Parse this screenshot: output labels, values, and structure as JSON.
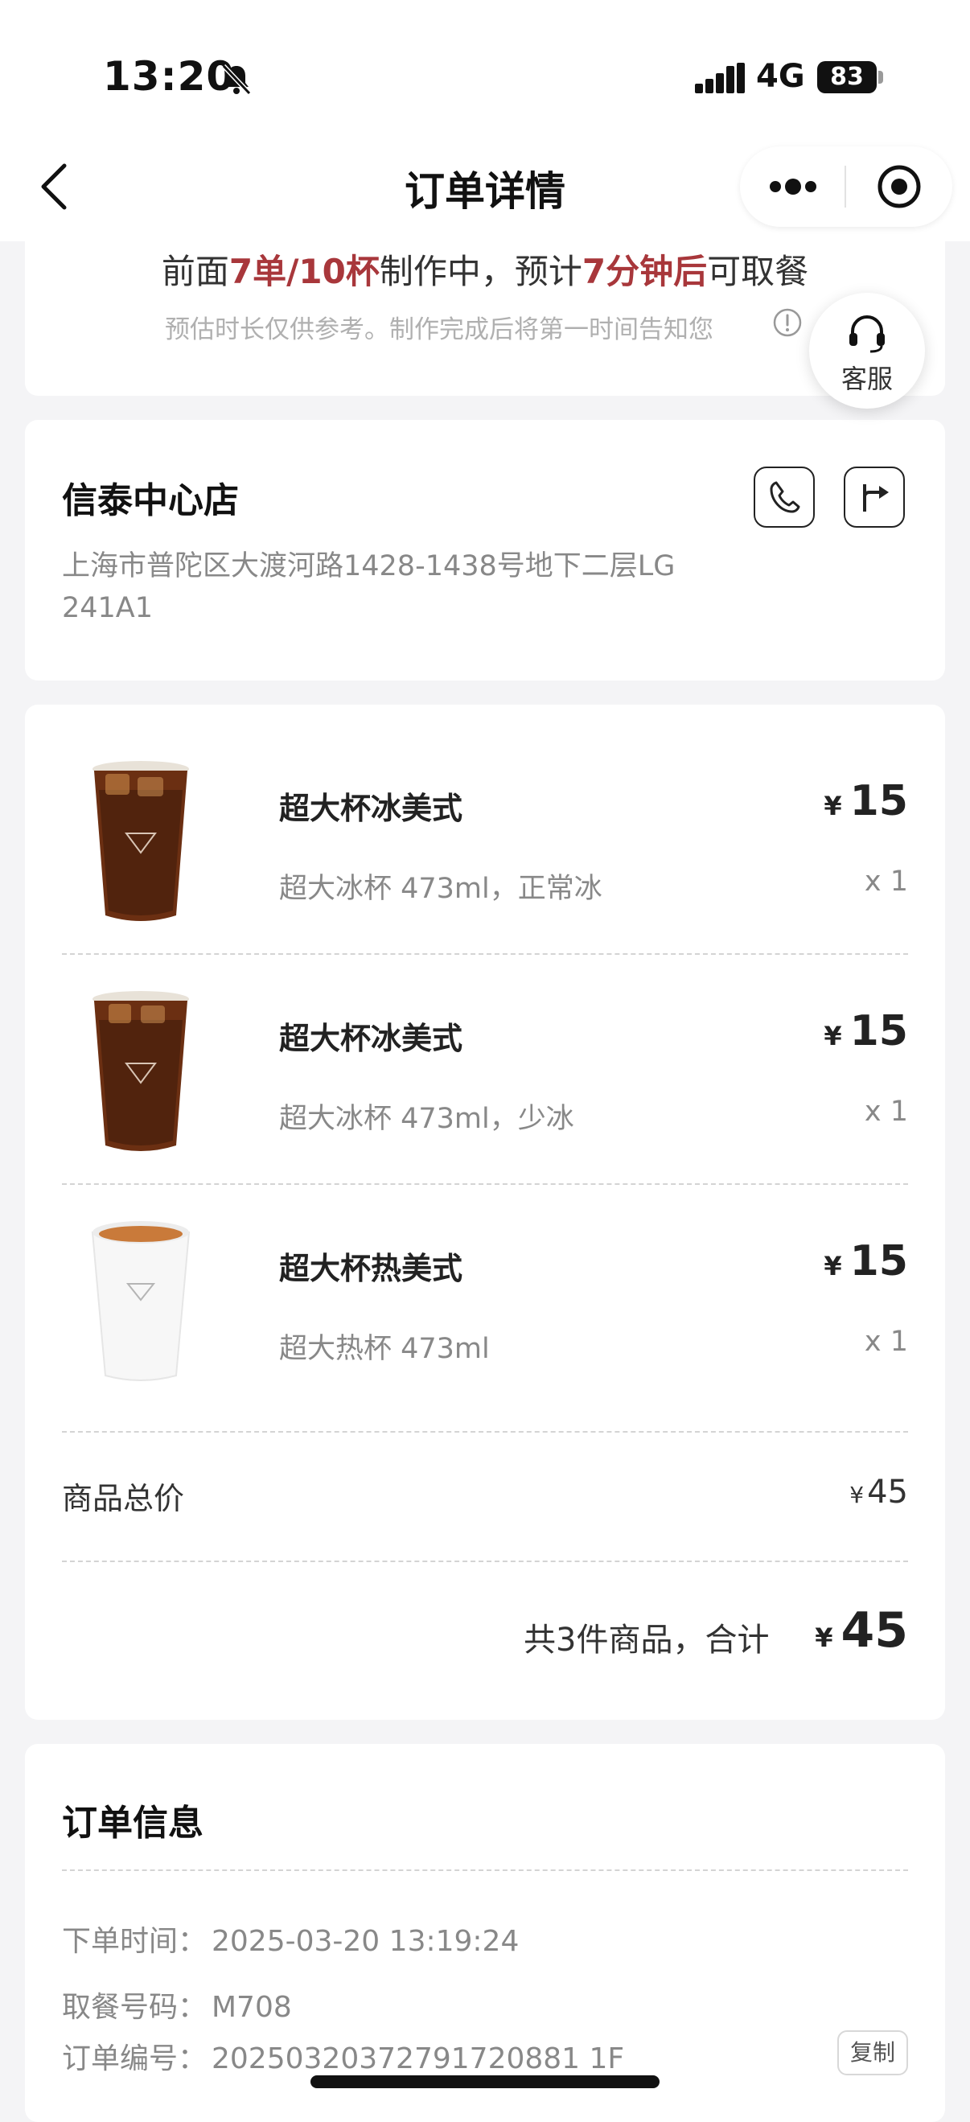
{
  "status_bar": {
    "time": "13:20",
    "network": "4G",
    "battery": "83"
  },
  "nav": {
    "title": "订单详情"
  },
  "queue": {
    "prefix": "前面",
    "orders_cups": "7单/10杯",
    "middle": "制作中，预计",
    "minutes": "7分钟后",
    "suffix": "可取餐",
    "note": "预估时长仅供参考。制作完成后将第一时间告知您"
  },
  "customer_service": {
    "label": "客服"
  },
  "store": {
    "name": "信泰中心店",
    "address": "上海市普陀区大渡河路1428-1438号地下二层LG 241A1"
  },
  "currency": "¥",
  "items": [
    {
      "name": "超大杯冰美式",
      "spec": "超大冰杯 473ml，正常冰",
      "price": "15",
      "qty": "x 1",
      "icon": "iced-americano-cup-icon"
    },
    {
      "name": "超大杯冰美式",
      "spec": "超大冰杯 473ml，少冰",
      "price": "15",
      "qty": "x 1",
      "icon": "iced-americano-cup-icon"
    },
    {
      "name": "超大杯热美式",
      "spec": "超大热杯 473ml",
      "price": "15",
      "qty": "x 1",
      "icon": "hot-americano-cup-icon"
    }
  ],
  "summary": {
    "subtotal_label": "商品总价",
    "subtotal_value": "45",
    "total_count_text": "共3件商品，合计",
    "total_value": "45"
  },
  "order_info": {
    "title": "订单信息",
    "fields": [
      {
        "label": "下单时间：",
        "value": "2025-03-20 13:19:24"
      },
      {
        "label": "取餐号码：",
        "value": "M708"
      },
      {
        "label": "订单编号：",
        "value": "20250320372791720881 1F"
      }
    ],
    "copy_label": "复制"
  },
  "colors": {
    "highlight": "#a8373b",
    "background": "#f4f4f6"
  }
}
